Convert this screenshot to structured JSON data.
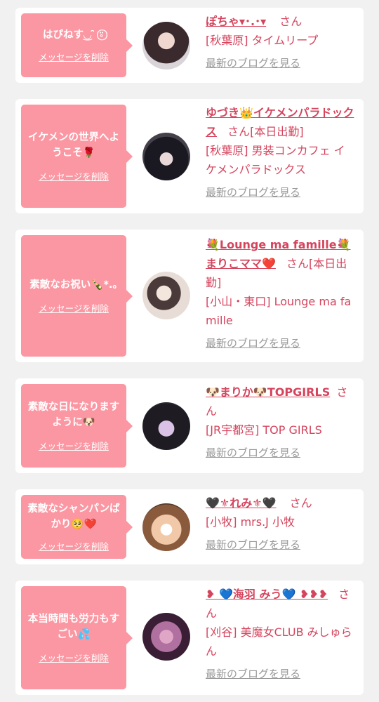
{
  "cards": [
    {
      "message": "はぴねす◟͜◞ ̑̑ ⍤⃝",
      "delete_label": "メッセージを削除",
      "name": "ぽちゃ▾･.･▾",
      "suffix": "さん",
      "shop": "[秋葉原] タイムリープ",
      "blog_label": "最新のブログを見る"
    },
    {
      "message": "イケメンの世界へようこそ🌹",
      "delete_label": "メッセージを削除",
      "name": "ゆづき👑イケメンパラドックス",
      "suffix": "さん[本日出勤]",
      "shop": "[秋葉原] 男装コンカフェ イケメンパラドックス",
      "blog_label": "最新のブログを見る"
    },
    {
      "message": "素敵なお祝い🍾*.｡",
      "delete_label": "メッセージを削除",
      "name": "💐Lounge ma famille💐まりこママ❤️",
      "suffix": "さん[本日出勤]",
      "shop": "[小山・東口] Lounge ma famille",
      "blog_label": "最新のブログを見る"
    },
    {
      "message": "素敵な日になりますように🐶",
      "delete_label": "メッセージを削除",
      "name": "🐶まりか🐶TOPGIRLS",
      "suffix": "さん",
      "shop": "[JR宇都宮] TOP GIRLS",
      "blog_label": "最新のブログを見る"
    },
    {
      "message": "素敵なシャンパンばかり🥺❤️",
      "delete_label": "メッセージを削除",
      "name": "🖤⚜れみ⚜🖤",
      "suffix": "さん",
      "shop": "[小牧] mrs.J 小牧",
      "blog_label": "最新のブログを見る"
    },
    {
      "message": "本当時間も労力もすごい💦",
      "delete_label": "メッセージを削除",
      "name": "❥ 💙海羽 みう💙 ❥❥❥",
      "suffix": "さん",
      "shop": "[刈谷] 美魔女CLUB みしゅらん",
      "blog_label": "最新のブログを見る"
    }
  ]
}
